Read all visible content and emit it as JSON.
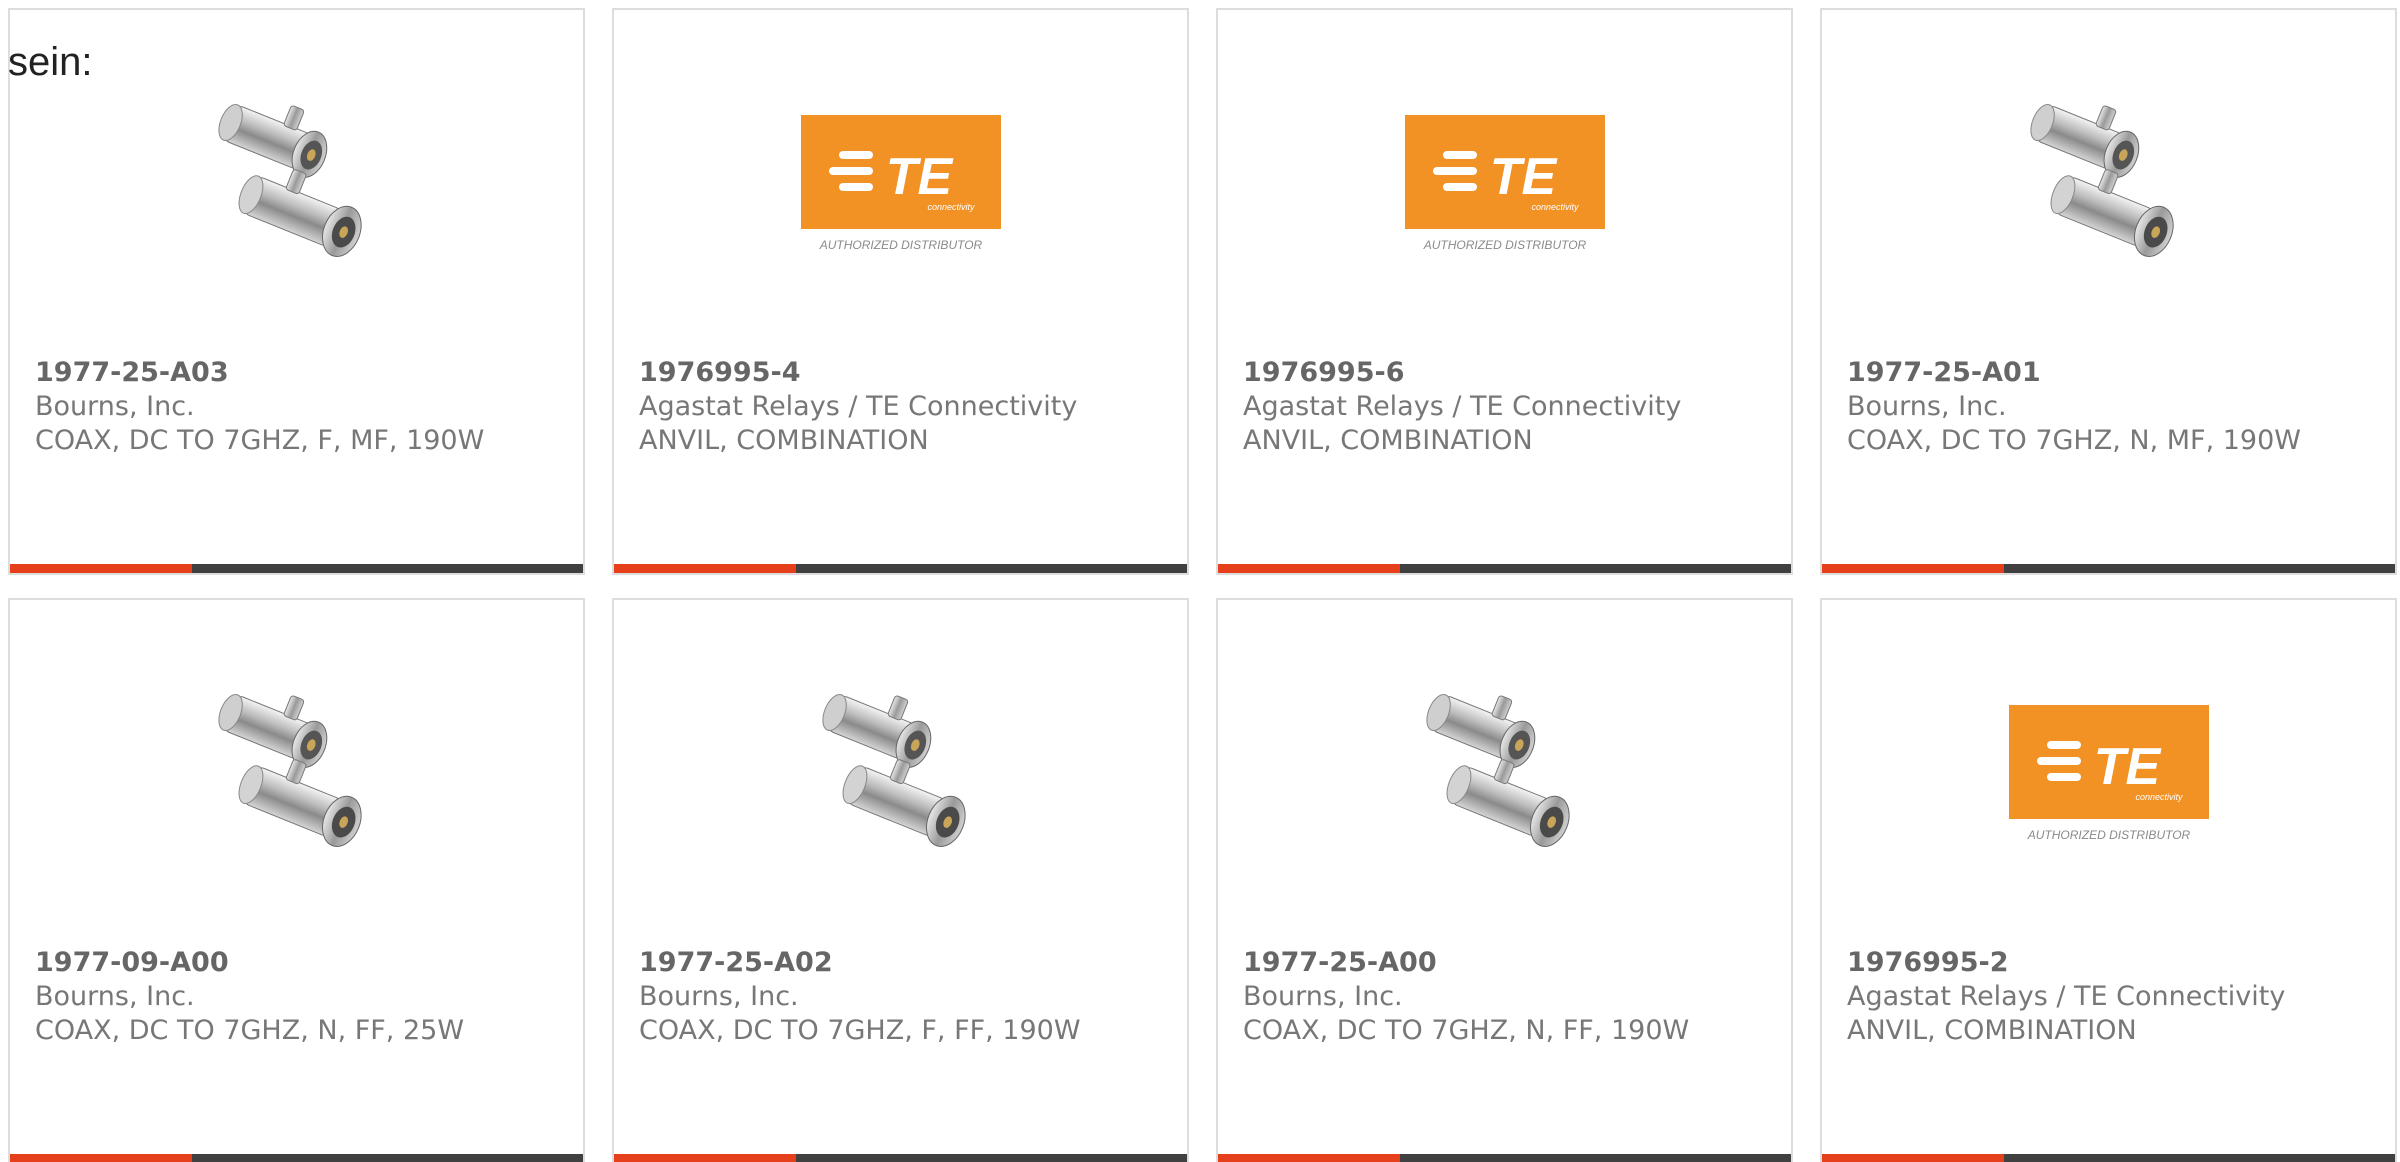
{
  "leading_text": "sein:",
  "colors": {
    "card_border": "#dddddd",
    "bar_track": "#404040",
    "bar_accent": "#e5401b",
    "te_orange": "#f39224",
    "text_muted": "#777777"
  },
  "products": [
    {
      "part_number": "1977-25-A03",
      "manufacturer": "Bourns, Inc.",
      "description": "COAX, DC TO 7GHZ, F, MF, 190W",
      "image": "coax-surge-protector-image"
    },
    {
      "part_number": "1976995-4",
      "manufacturer": "Agastat Relays / TE Connectivity",
      "description": "ANVIL, COMBINATION",
      "image": "te-connectivity-logo"
    },
    {
      "part_number": "1976995-6",
      "manufacturer": "Agastat Relays / TE Connectivity",
      "description": "ANVIL, COMBINATION",
      "image": "te-connectivity-logo"
    },
    {
      "part_number": "1977-25-A01",
      "manufacturer": "Bourns, Inc.",
      "description": "COAX, DC TO 7GHZ, N, MF, 190W",
      "image": "coax-surge-protector-image"
    },
    {
      "part_number": "1977-09-A00",
      "manufacturer": "Bourns, Inc.",
      "description": "COAX, DC TO 7GHZ, N, FF, 25W",
      "image": "coax-surge-protector-image"
    },
    {
      "part_number": "1977-25-A02",
      "manufacturer": "Bourns, Inc.",
      "description": "COAX, DC TO 7GHZ, F, FF, 190W",
      "image": "coax-surge-protector-image"
    },
    {
      "part_number": "1977-25-A00",
      "manufacturer": "Bourns, Inc.",
      "description": "COAX, DC TO 7GHZ, N, FF, 190W",
      "image": "coax-surge-protector-image"
    },
    {
      "part_number": "1976995-2",
      "manufacturer": "Agastat Relays / TE Connectivity",
      "description": "ANVIL, COMBINATION",
      "image": "te-connectivity-logo"
    }
  ],
  "te_logo": {
    "wordmark": "TE",
    "subtext": "connectivity",
    "caption": "AUTHORIZED DISTRIBUTOR"
  }
}
